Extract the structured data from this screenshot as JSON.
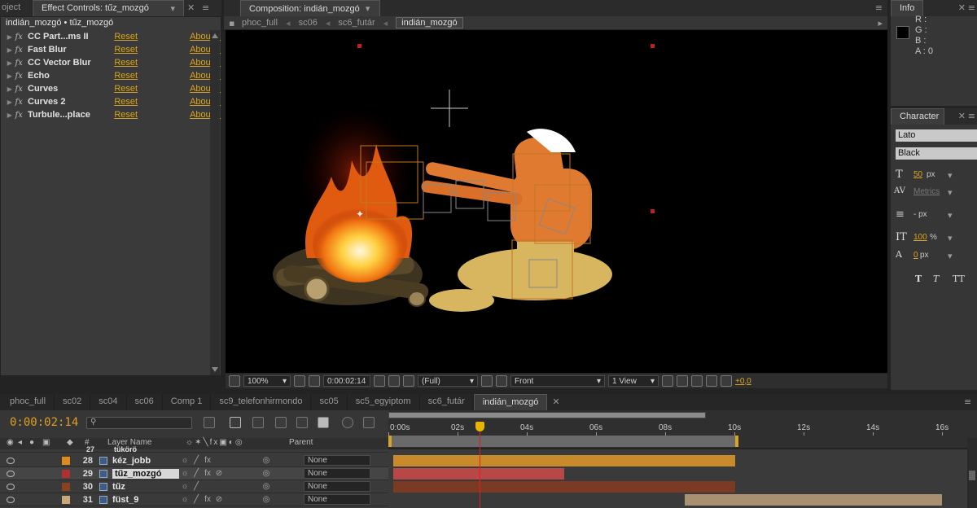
{
  "project_tab": "oject",
  "effect_controls": {
    "tab_title": "Effect Controls: tűz_mozgó",
    "breadcrumb": "indián_mozgó • tűz_mozgó",
    "effects": [
      {
        "name": "CC Part...ms II",
        "reset": "Reset",
        "about": "About..."
      },
      {
        "name": "Fast Blur",
        "reset": "Reset",
        "about": "About..."
      },
      {
        "name": "CC Vector Blur",
        "reset": "Reset",
        "about": "About..."
      },
      {
        "name": "Echo",
        "reset": "Reset",
        "about": "About..."
      },
      {
        "name": "Curves",
        "reset": "Reset",
        "about": "About..."
      },
      {
        "name": "Curves 2",
        "reset": "Reset",
        "about": "About..."
      },
      {
        "name": "Turbule...place",
        "reset": "Reset",
        "about": "About..."
      }
    ],
    "fx_symbol": "fx"
  },
  "composition": {
    "tab_title": "Composition: indián_mozgó",
    "flow_tabs": [
      "phoc_full",
      "sc06",
      "sc6_futár",
      "indián_mozgó"
    ],
    "zoom": "100%",
    "timecode": "0:00:02:14",
    "resolution": "(Full)",
    "view": "Front",
    "views": "1 View",
    "exposure": "+0,0"
  },
  "info": {
    "title": "Info",
    "r": "R :",
    "g": "G :",
    "b": "B :",
    "a": "A : 0"
  },
  "character": {
    "title": "Character",
    "font": "Lato",
    "style": "Black",
    "size": "50",
    "size_unit": "px",
    "tracking_mode": "Metrics",
    "leading_unit": "- px",
    "vscale": "100",
    "vscale_unit": "%",
    "baseline": "0",
    "baseline_unit": "px",
    "style_buttons": [
      "T",
      "T",
      "TT"
    ]
  },
  "timeline": {
    "comp_tabs": [
      "phoc_full",
      "sc02",
      "sc04",
      "sc06",
      "Comp 1",
      "sc9_telefonhirmondo",
      "sc05",
      "sc5_egyiptom",
      "sc6_futár",
      "indián_mozgó"
    ],
    "timecode": "0:00:02:14",
    "col_num": "#",
    "col_layer": "Layer Name",
    "col_parent": "Parent",
    "ruler": [
      "0s",
      "02s",
      "04s",
      "06s",
      "08s",
      "10s",
      "12s",
      "14s",
      "16s"
    ],
    "ruler_start_label": "0:00s",
    "partial_row": {
      "num": "27",
      "name": "tükörö"
    },
    "layers": [
      {
        "num": "28",
        "name": "kéz_jobb",
        "color": "#e08a1e",
        "parent": "None"
      },
      {
        "num": "29",
        "name": "tűz_mozgó",
        "color": "#b03030",
        "parent": "None"
      },
      {
        "num": "30",
        "name": "tűz",
        "color": "#8b4020",
        "parent": "None"
      },
      {
        "num": "31",
        "name": "füst_9",
        "color": "#c8a878",
        "parent": "None"
      }
    ]
  },
  "colors": {
    "accent": "#d9a420",
    "playhead": "#e02020"
  }
}
